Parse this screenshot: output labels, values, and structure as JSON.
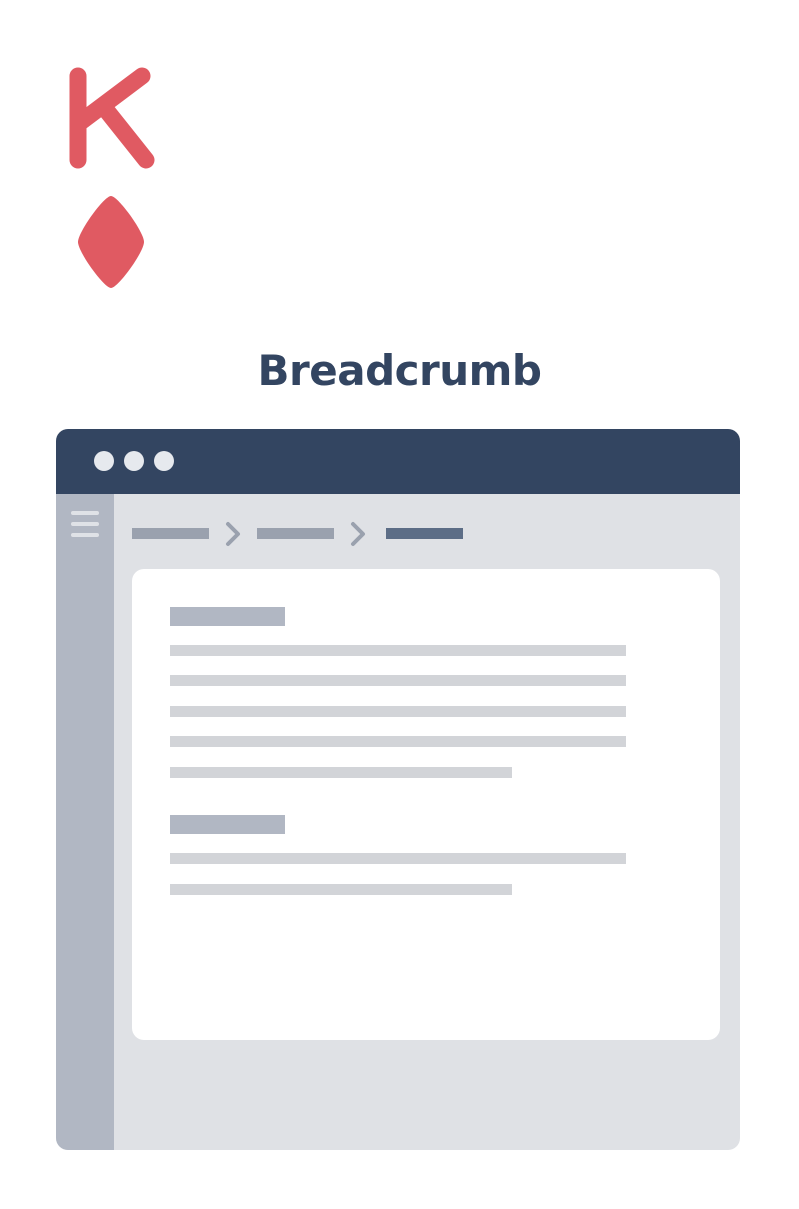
{
  "card": {
    "rank": "K",
    "suit_icon": "diamond-icon",
    "color": "#e05a62"
  },
  "title": "Breadcrumb",
  "colors": {
    "title": "#334561",
    "titlebar": "#334561",
    "sidebar": "#b1b7c3",
    "crumb_inactive": "#9aa1ae",
    "crumb_active": "#5c6d86",
    "separator": "#9aa1ae",
    "content_bg": "#ffffff",
    "window_bg": "#dfe1e5"
  },
  "window": {
    "controls": [
      "window-dot-icon",
      "window-dot-icon",
      "window-dot-icon"
    ],
    "menu_icon": "hamburger-icon",
    "separator_icon": "chevron-right-icon"
  }
}
